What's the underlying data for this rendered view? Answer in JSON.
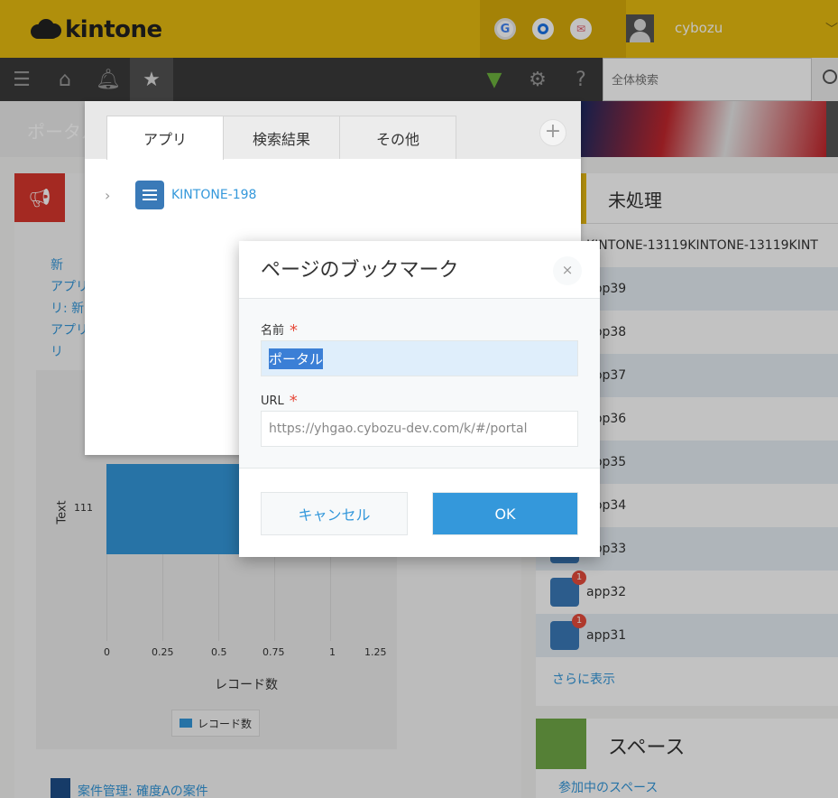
{
  "header": {
    "logo_text": "kintone",
    "icons": [
      {
        "name": "google-icon",
        "glyph": "G",
        "color": "#4285f4"
      },
      {
        "name": "browser-icon",
        "glyph": "O",
        "color": "#1a73e8"
      },
      {
        "name": "mail-icon",
        "glyph": "✉",
        "color": "#e05a6a"
      }
    ],
    "username": "cybozu"
  },
  "gnav": {
    "search_placeholder": "全体検索",
    "icons": [
      "menu-icon",
      "home-icon",
      "bell-icon",
      "star-icon",
      "beginner-icon",
      "gear-icon",
      "help-icon",
      "search-icon"
    ]
  },
  "portal": {
    "banner_title": "ポータル",
    "left_text_lines": [
      "新",
      "アプリ",
      "リ: 新",
      "アプリ",
      "リ"
    ],
    "bottom_link": "案件管理: 確度Aの案件"
  },
  "chart_data": {
    "type": "bar",
    "orientation": "horizontal",
    "categories": [
      "111"
    ],
    "series": [
      {
        "name": "レコード数",
        "values": [
          1
        ]
      }
    ],
    "xlabel": "レコード数",
    "ylabel": "Text",
    "xticks": [
      "0",
      "0.25",
      "0.5",
      "0.75",
      "1",
      "1.25"
    ],
    "xlim": [
      0,
      1.25
    ],
    "legend": "bottom"
  },
  "unprocessed": {
    "title": "未処理",
    "rows": [
      {
        "label": "KINTONE-13119KINTONE-13119KINT",
        "badge": ""
      },
      {
        "label": "app39",
        "badge": ""
      },
      {
        "label": "app38",
        "badge": ""
      },
      {
        "label": "app37",
        "badge": ""
      },
      {
        "label": "app36",
        "badge": ""
      },
      {
        "label": "app35",
        "badge": ""
      },
      {
        "label": "app34",
        "badge": ""
      },
      {
        "label": "app33",
        "badge": ""
      },
      {
        "label": "app32",
        "badge": "1"
      },
      {
        "label": "app31",
        "badge": "1"
      }
    ],
    "more_link": "さらに表示"
  },
  "spaces": {
    "title": "スペース",
    "link": "参加中のスペース"
  },
  "favorites": {
    "tabs": [
      "アプリ",
      "検索結果",
      "その他"
    ],
    "add_label": "+",
    "item_label": "KINTONE-198"
  },
  "modal": {
    "title": "ページのブックマーク",
    "close_label": "×",
    "name_label": "名前",
    "name_value": "ポータル",
    "url_label": "URL",
    "url_value": "https://yhgao.cybozu-dev.com/k/#/portal",
    "required_mark": "*",
    "cancel_label": "キャンセル",
    "ok_label": "OK"
  }
}
